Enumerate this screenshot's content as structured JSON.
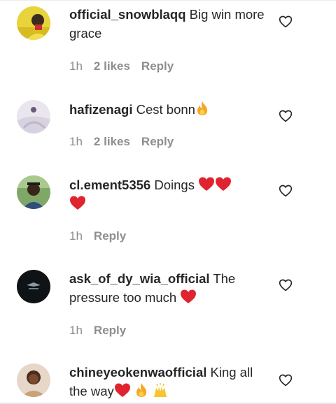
{
  "comments": [
    {
      "username": "official_snowblaqq",
      "text": "Big win more grace",
      "time": "1h",
      "likes": "2 likes",
      "reply": "Reply",
      "avatar_icon": "profile-photo-yellow-icon"
    },
    {
      "username": "hafizenagi",
      "text": "Cest bonn",
      "time": "1h",
      "likes": "2 likes",
      "reply": "Reply",
      "avatar_icon": "profile-photo-white-icon"
    },
    {
      "username": "cl.ement5356",
      "text": "Doings",
      "time": "1h",
      "likes": "",
      "reply": "Reply",
      "avatar_icon": "profile-photo-person-icon"
    },
    {
      "username": "ask_of_dy_wia_official",
      "text": "The pressure too much",
      "time": "1h",
      "likes": "",
      "reply": "Reply",
      "avatar_icon": "profile-photo-dark-logo-icon"
    },
    {
      "username": "chineyeokenwaofficial",
      "text": "King all the way",
      "time": "",
      "likes": "",
      "reply": "",
      "avatar_icon": "profile-photo-woman-icon"
    }
  ],
  "colors": {
    "username": "#262626",
    "meta": "#8e8e8e",
    "heart_emoji": "#e0242f",
    "fire_emoji": "#f5a623"
  }
}
